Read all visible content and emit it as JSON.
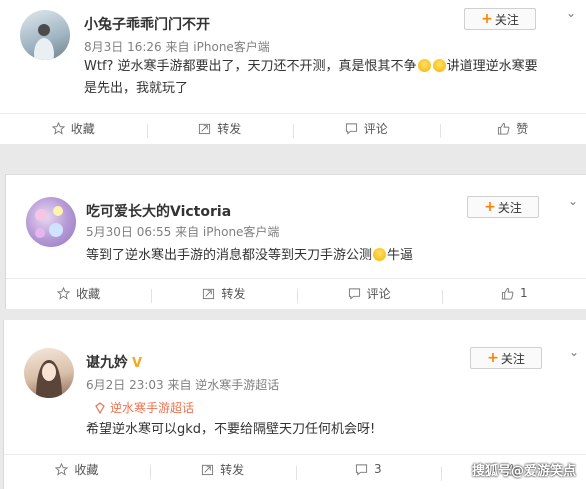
{
  "posts": [
    {
      "username": "小兔子乖乖门门不开",
      "meta": "8月3日 16:26 来自 iPhone客户端",
      "follow_label": "关注",
      "text_line1_a": "Wtf? 逆水寒手游都要出了，天刀还不开测，真是恨其不争",
      "text_line1_b": "讲道理逆水寒要",
      "text_line2": "是先出，我就玩了",
      "actions": [
        "收藏",
        "转发",
        "评论",
        "赞"
      ]
    },
    {
      "username": "吃可爱长大的Victoria",
      "meta": "5月30日 06:55 来自 iPhone客户端",
      "follow_label": "关注",
      "text_a": "等到了逆水寒出手游的消息都没等到天刀手游公测",
      "text_b": "牛逼",
      "actions": [
        "收藏",
        "转发",
        "评论",
        "1"
      ]
    },
    {
      "username": "谌九妗",
      "meta": "6月2日 23:03 来自 逆水寒手游超话",
      "topic": "逆水寒手游超话",
      "follow_label": "关注",
      "text": "希望逆水寒可以gkd，不要给隔壁天刀任何机会呀!",
      "actions": [
        "收藏",
        "转发",
        "3"
      ]
    }
  ],
  "watermark": "搜狐号@爱游笑点",
  "colors": {
    "accent": "#ff8200",
    "topic": "#eb7350"
  }
}
